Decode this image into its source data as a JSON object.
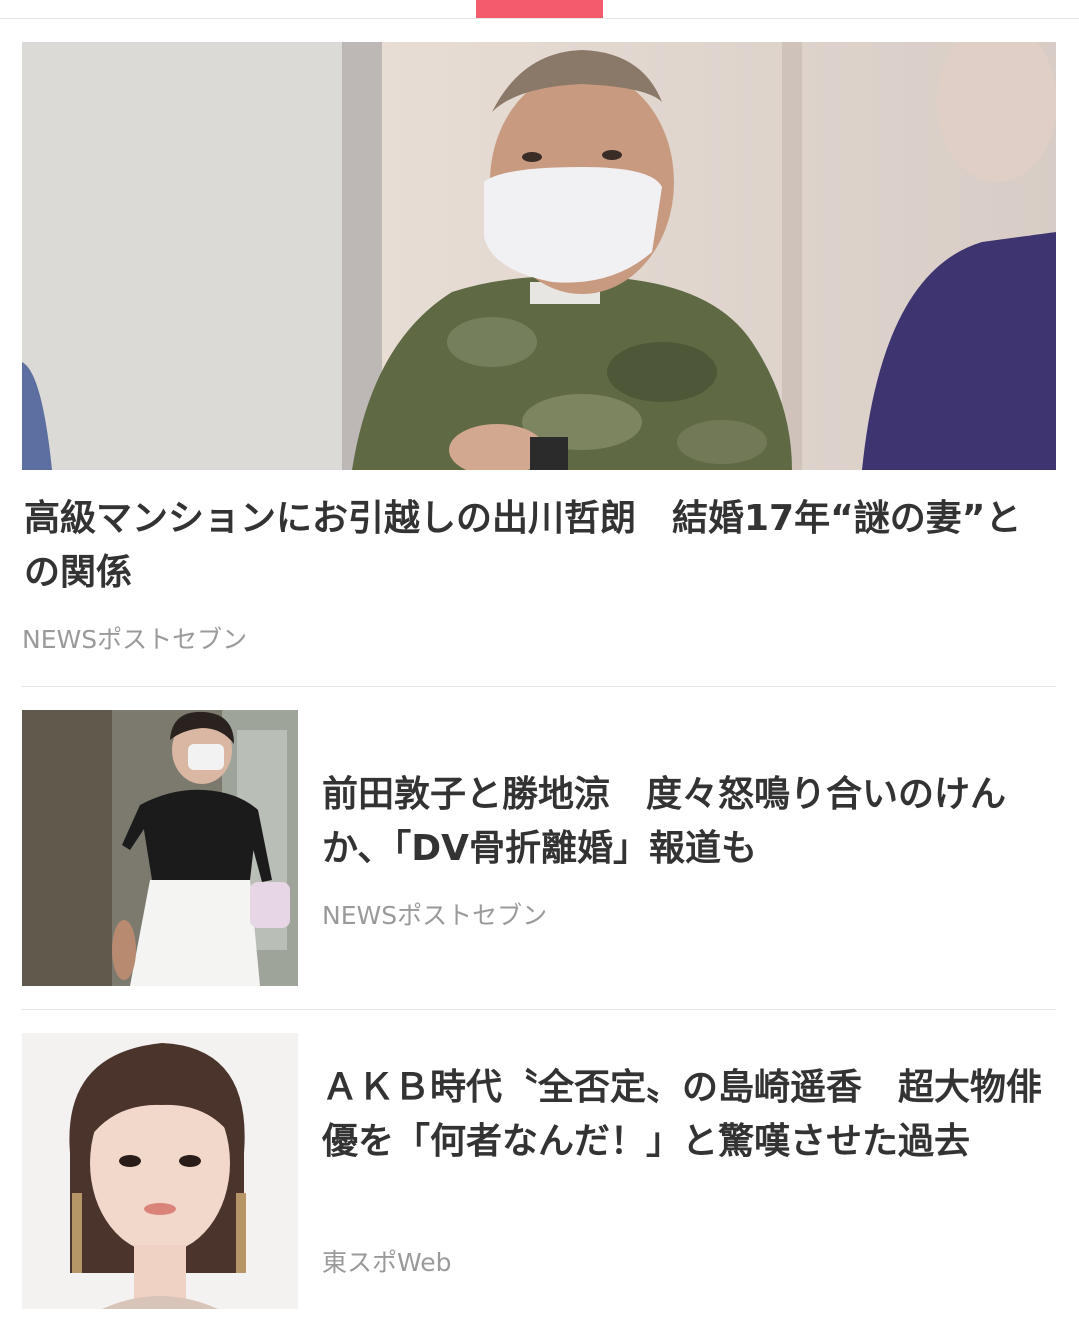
{
  "articles": [
    {
      "title": "高級マンションにお引越しの出川哲朗　結婚17年“謎の妻”との関係",
      "source": "NEWSポストセブン"
    },
    {
      "title": "前田敦子と勝地涼　度々怒鳴り合いのけんか、「DV骨折離婚」報道も",
      "source": "NEWSポストセブン"
    },
    {
      "title": "ＡＫＢ時代〝全否定〟の島崎遥香　超大物俳優を「何者なんだ！」と驚嘆させた過去",
      "source": "東スポWeb"
    }
  ],
  "colors": {
    "accent": "#f45b6c",
    "title_text": "#333333",
    "source_text": "#9a9a9a",
    "divider": "#e3e3e3"
  }
}
